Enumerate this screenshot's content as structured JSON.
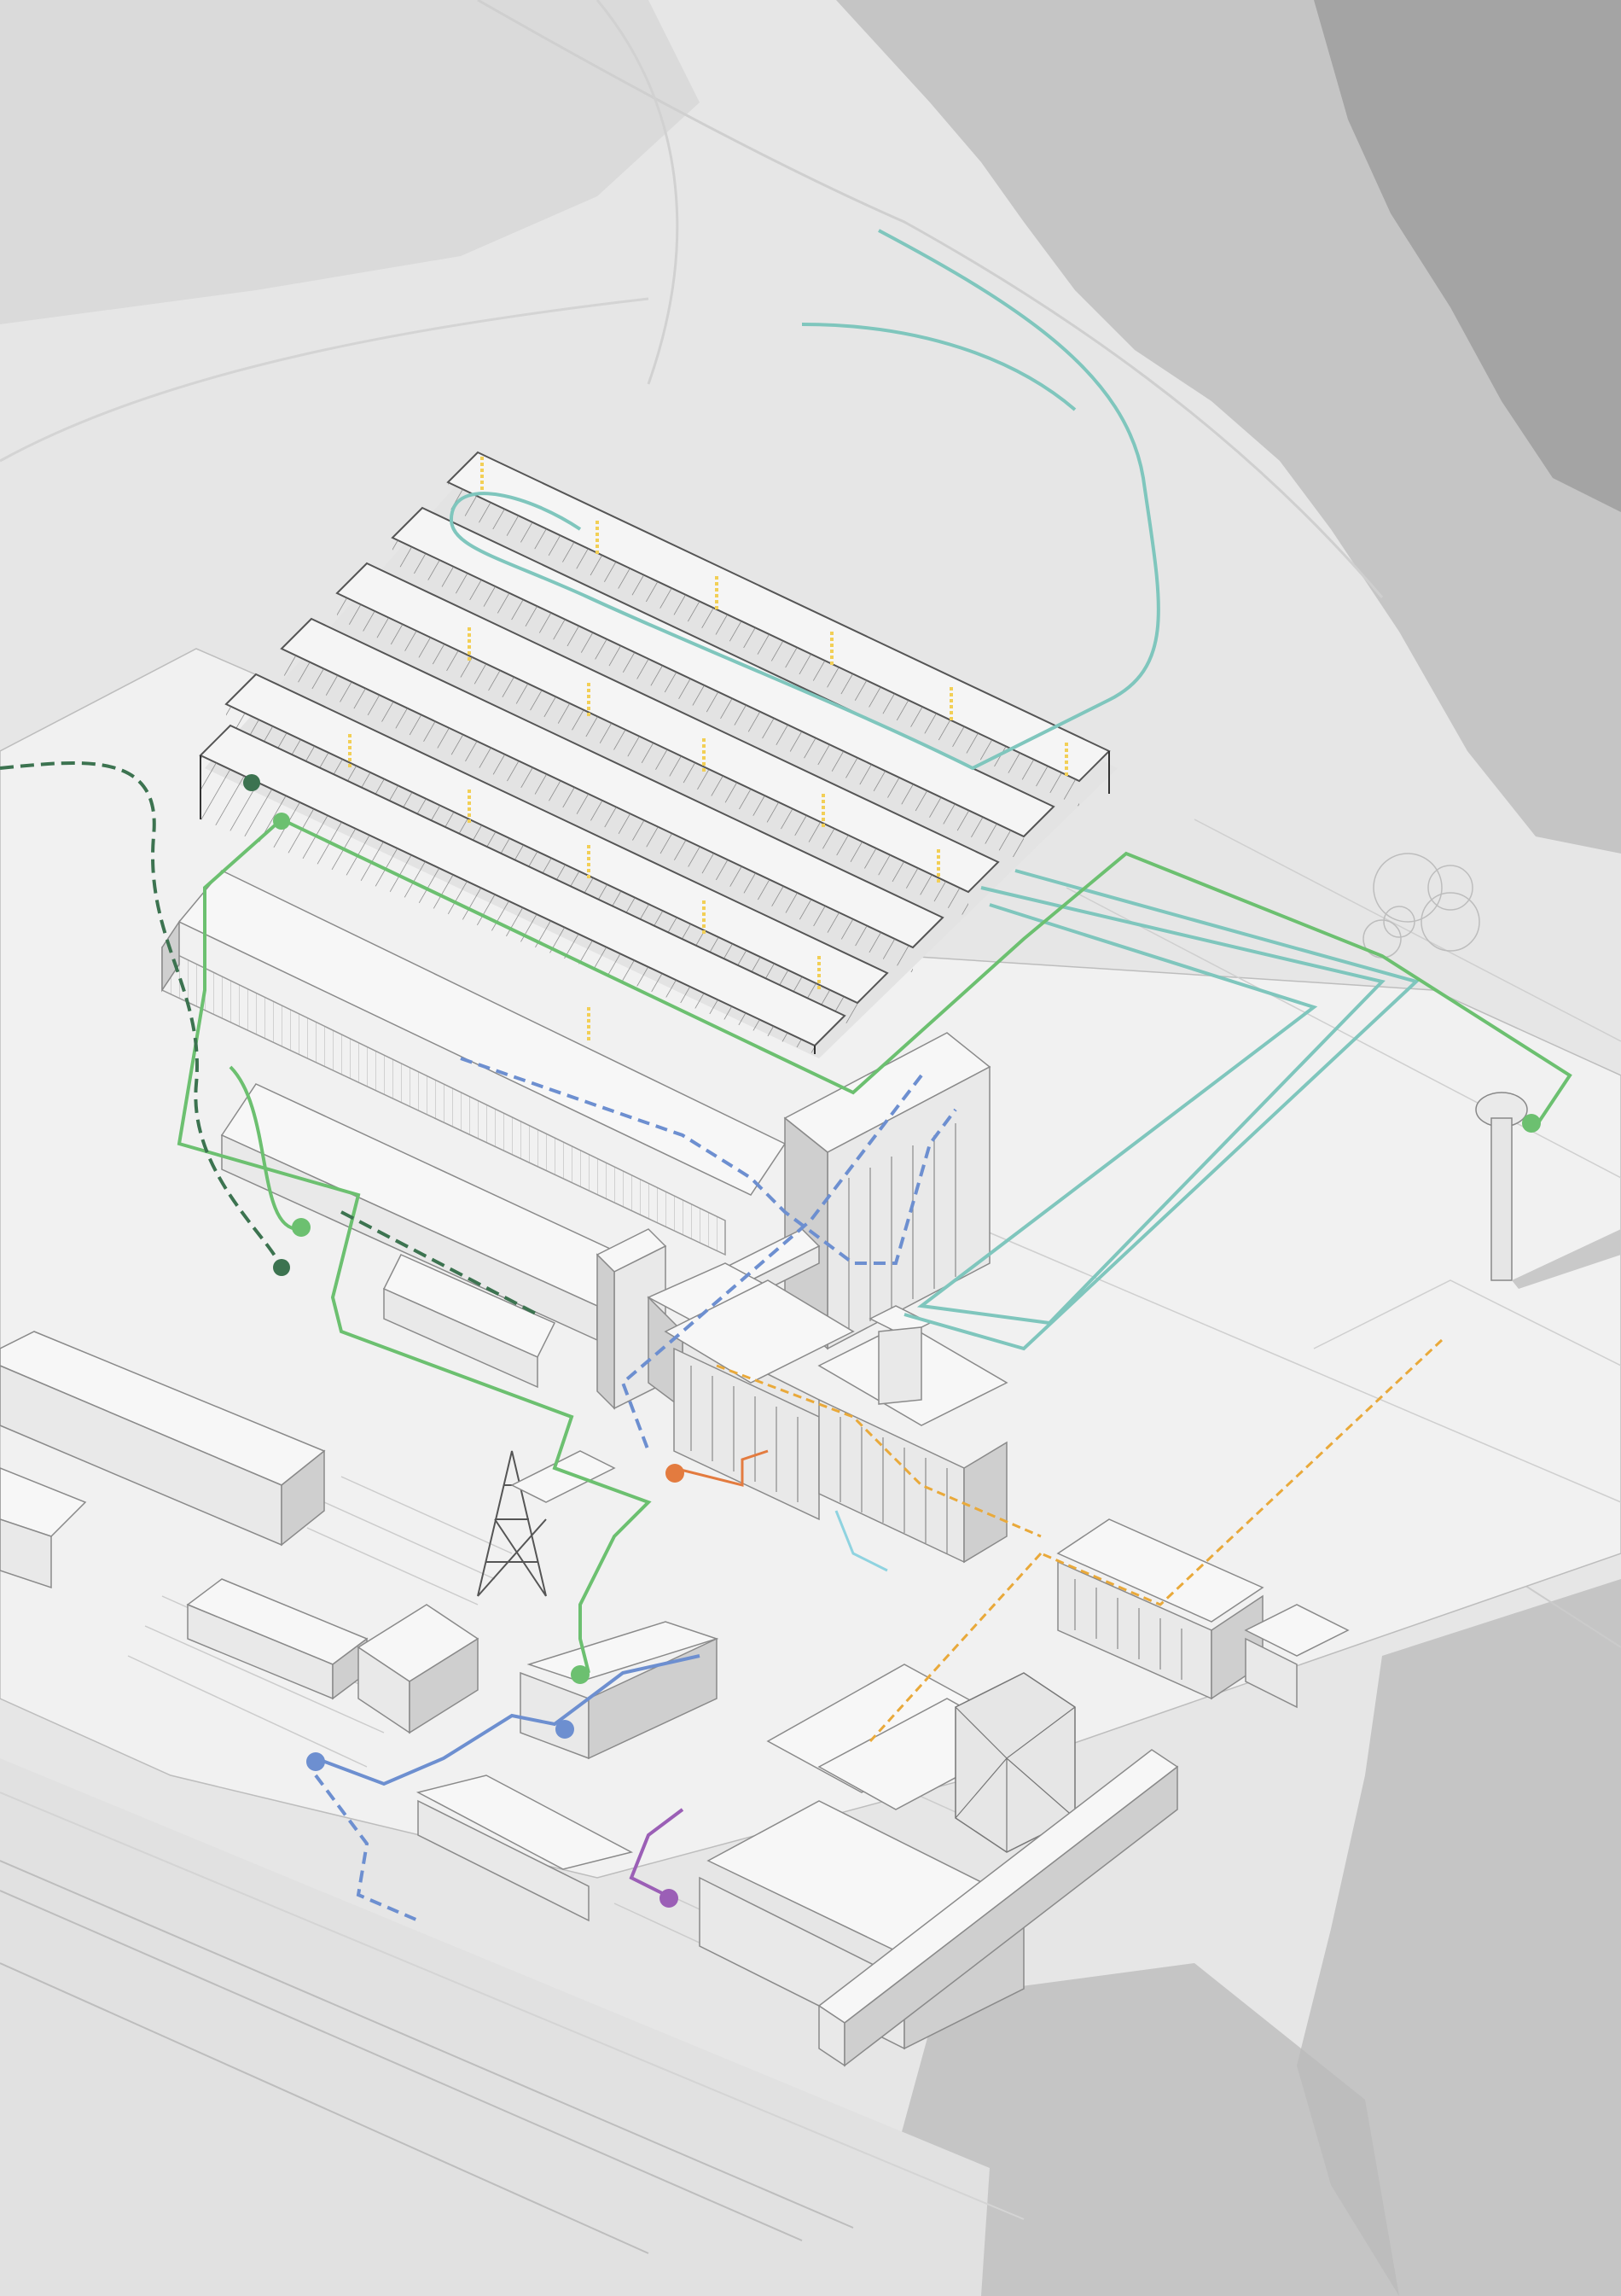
{
  "diagram": {
    "kind": "isometric-site-axonometric",
    "text_labels": [],
    "background": {
      "terrain": "#e6e6e6",
      "vegetation": "#b9b9b9",
      "vegetation_dark": "#8e8e8e"
    },
    "building_style": {
      "roof": "#f7f7f7",
      "wall_light": "#e9e9e9",
      "wall_shade": "#cfcfcf",
      "outline": "#8a8a8a"
    },
    "routes": [
      {
        "name": "teal-route",
        "color": "#7fc6bd",
        "style": "solid"
      },
      {
        "name": "green-route",
        "color": "#6cc070",
        "style": "solid"
      },
      {
        "name": "dark-green-route",
        "color": "#3c7350",
        "style": "dashed"
      },
      {
        "name": "blue-route",
        "color": "#6d8fd0",
        "style": "dashed"
      },
      {
        "name": "orange-route",
        "color": "#e9a93a",
        "style": "dashed"
      },
      {
        "name": "purple-route",
        "color": "#9b5fb6",
        "style": "solid"
      },
      {
        "name": "light-blue-route",
        "color": "#8fd3e0",
        "style": "solid"
      },
      {
        "name": "dark-orange-route",
        "color": "#e37b3f",
        "style": "solid"
      }
    ],
    "markers_color": "#f2cf56"
  }
}
